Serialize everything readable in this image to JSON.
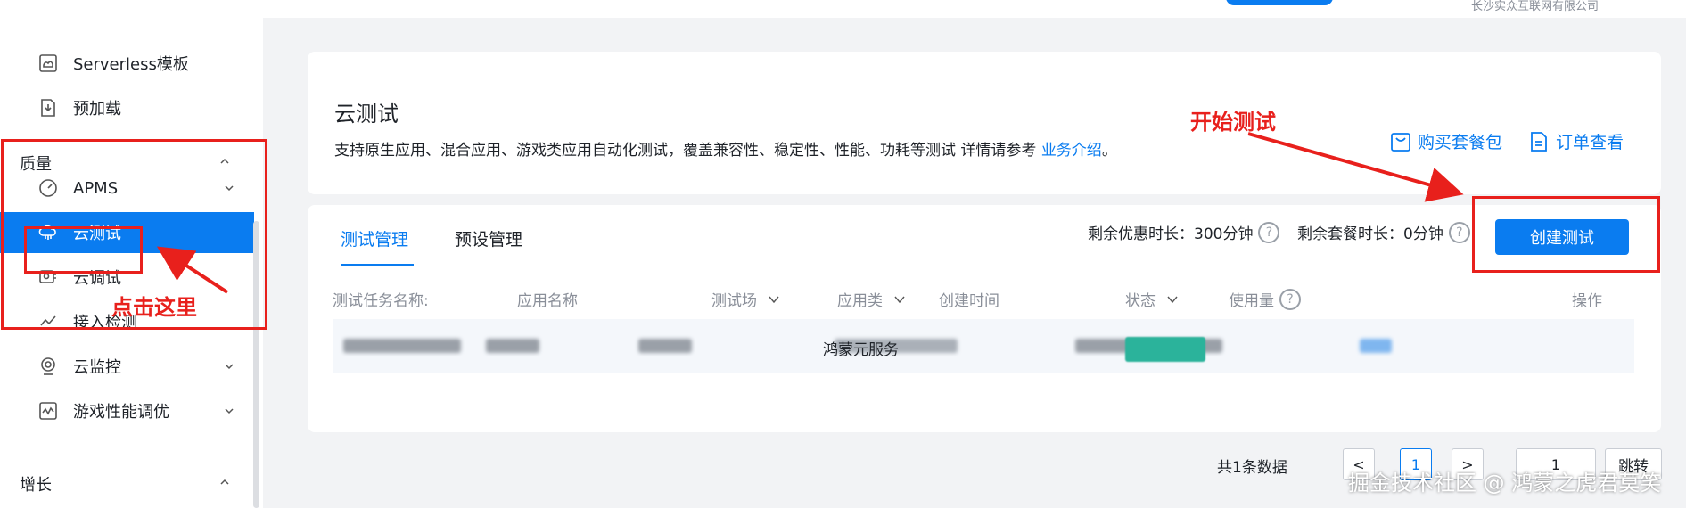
{
  "topbar": {
    "company": "长沙实众互联网有限公司"
  },
  "sidebar": {
    "items_top": [
      {
        "label": "Serverless模板",
        "icon": "template-icon"
      },
      {
        "label": "预加载",
        "icon": "preload-icon"
      }
    ],
    "group_quality": "质量",
    "items_quality": [
      {
        "label": "APMS",
        "icon": "gauge-icon"
      },
      {
        "label": "云测试",
        "icon": "cloud-test-icon"
      },
      {
        "label": "云调试",
        "icon": "cloud-debug-icon"
      },
      {
        "label": "接入检测",
        "icon": "chart-check-icon"
      },
      {
        "label": "云监控",
        "icon": "monitor-icon"
      },
      {
        "label": "游戏性能调优",
        "icon": "game-perf-icon"
      }
    ],
    "group_growth": "增长"
  },
  "header": {
    "title": "云测试",
    "desc": "支持原生应用、混合应用、游戏类应用自动化测试，覆盖兼容性、稳定性、性能、功耗等测试  详情请参考 ",
    "desc_link": "业务介绍",
    "desc_end": "。",
    "buy_label": "购买套餐包",
    "order_label": "订单查看"
  },
  "main": {
    "tabs": [
      {
        "label": "测试管理"
      },
      {
        "label": "预设管理"
      }
    ],
    "discount_label": "剩余优惠时长：300分钟",
    "package_label": "剩余套餐时长：0分钟",
    "create_label": "创建测试",
    "columns": [
      "测试任务名称:",
      "应用名称",
      "测试场",
      "应用类",
      "创建时间",
      "状态",
      "使用量",
      "操作"
    ],
    "row": {
      "app_type": "鸿蒙元服务"
    }
  },
  "pager": {
    "total": "共1条数据",
    "prev": "<",
    "page": "1",
    "next": ">",
    "input": "1",
    "jump": "跳转"
  },
  "annotations": {
    "start_test": "开始测试",
    "click_here": "点击这里"
  },
  "watermark": "掘金技术社区 @ 鸿蒙之虎君莫笑",
  "colors": {
    "accent": "#0a7cf0",
    "annotation": "#e8201c",
    "status": "#2bb39b"
  }
}
